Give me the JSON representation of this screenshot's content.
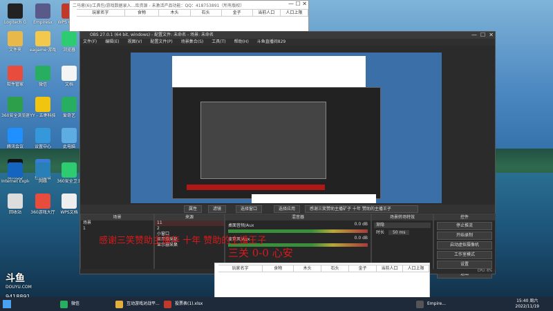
{
  "spreadsheet_top": {
    "title": "二马崽(6)/工具包/游戏数据录入…库资源 - 未激活产品功能：QQ：418753891（所有版权）",
    "headers": [
      "玩家名字",
      "食物",
      "木头",
      "石头",
      "金子",
      "当前人口",
      "人口上限"
    ]
  },
  "spreadsheet_bottom": {
    "headers": [
      "玩家名字",
      "食物",
      "木头",
      "石头",
      "金子",
      "当前人口",
      "人口上限"
    ]
  },
  "desktop_icons": [
    {
      "label": "Logitech G",
      "color": "#222222"
    },
    {
      "label": "Empiresx",
      "color": "#5a5a8a"
    },
    {
      "label": "WPS Office",
      "color": "#c0392b"
    },
    {
      "label": "文件夹",
      "color": "#e8b84a"
    },
    {
      "label": "eagame·游戏",
      "color": "#f2c94c"
    },
    {
      "label": "浏览器",
      "color": "#2ecc71"
    },
    {
      "label": "软件管家",
      "color": "#e74c3c"
    },
    {
      "label": "微信",
      "color": "#27ae60"
    },
    {
      "label": "文档",
      "color": "#f5f5f5"
    },
    {
      "label": "360安全浏览器",
      "color": "#2d9f4a"
    },
    {
      "label": "YY - 五枣科技",
      "color": "#f1c40f"
    },
    {
      "label": "爱奇艺",
      "color": "#27ae60"
    },
    {
      "label": "腾讯会议",
      "color": "#1e90ff"
    },
    {
      "label": "设置中心",
      "color": "#3498db"
    },
    {
      "label": "此电脑",
      "color": "#5dade2"
    },
    {
      "label": "腾讯QQ",
      "color": "#111111"
    },
    {
      "label": "控制面板",
      "color": "#3a7bd5"
    },
    {
      "label": "Internet Explorer",
      "color": "#1565c0"
    },
    {
      "label": "网络",
      "color": "#2980b9"
    },
    {
      "label": "360安全卫士",
      "color": "#2ecc71"
    },
    {
      "label": "回收站",
      "color": "#dddddd"
    },
    {
      "label": "360游戏大厅",
      "color": "#e74c3c"
    },
    {
      "label": "WPS文档",
      "color": "#eeeeee"
    }
  ],
  "obs": {
    "title": "OBS 27.0.1 (64 bit, windows) - 配置文件: 未命名 - 场景: 未命名",
    "menu": [
      "文件(F)",
      "编辑(E)",
      "视图(V)",
      "配置文件(P)",
      "场景集合(S)",
      "工具(T)",
      "帮助(H)",
      "斗鱼直播间829"
    ],
    "source_bar": {
      "props": "属性",
      "filters": "滤镜",
      "window": "选择窗口",
      "app": "选择应用",
      "marquee": "感谢三笑赞助主播矿子 十年 赞助的主播王子"
    },
    "scenes_title": "场景",
    "scenes": [
      "场景",
      "1"
    ],
    "sources_title": "来源",
    "sources": [
      "11",
      "2",
      "小窗口",
      "显示器采集",
      "显示器采集"
    ],
    "mixer_title": "混音器",
    "mixer": [
      {
        "name": "桌面音频/Aux",
        "db": "0.0 dB"
      },
      {
        "name": "麦克风/Aux",
        "db": "0.0 dB"
      }
    ],
    "transition_title": "场景转场特效",
    "transition_value": "渐隐",
    "duration_label": "时长",
    "duration_value": "50 ms",
    "controls_title": "控件",
    "controls": [
      "停止推流",
      "开始录制",
      "启动虚拟摄像机",
      "工作室模式",
      "设置",
      "退出"
    ],
    "status": "CPU: 6%"
  },
  "overlay": {
    "line1": "感谢三笑赞助主播华 十年 赞助的主播王子",
    "line2": "三关 0-0 心安"
  },
  "watermark": {
    "brand": "斗鱼",
    "site": "DOUYU.COM",
    "room": "9418891"
  },
  "taskbar": {
    "items": [
      "微信",
      "互动游戏对战平...",
      "投票表(1).xlsx",
      "Empire..."
    ],
    "time": "15:40 周六",
    "date": "2022/11/19"
  }
}
